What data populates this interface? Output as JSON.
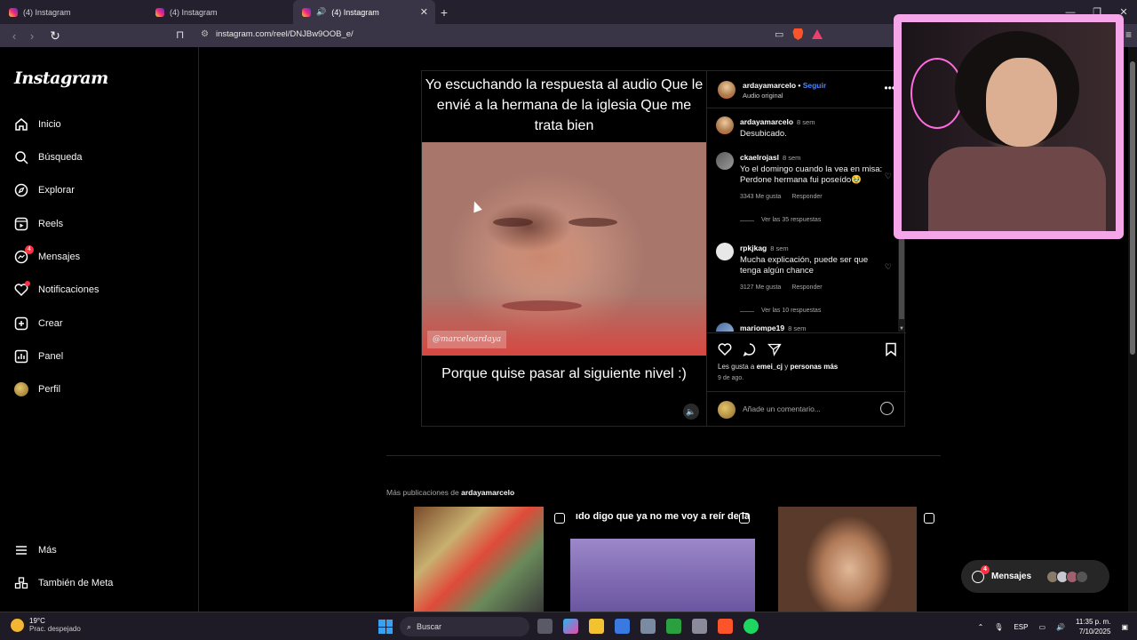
{
  "browser": {
    "tabs": [
      {
        "title": "(4) Instagram",
        "active": false
      },
      {
        "title": "(4) Instagram",
        "active": false
      },
      {
        "title": "(4) Instagram",
        "active": true
      }
    ],
    "url": "instagram.com/reel/DNJBw9OOB_e/"
  },
  "sidebar": {
    "logo": "Instagram",
    "items": [
      {
        "label": "Inicio",
        "icon": "home-icon"
      },
      {
        "label": "Búsqueda",
        "icon": "search-icon"
      },
      {
        "label": "Explorar",
        "icon": "compass-icon"
      },
      {
        "label": "Reels",
        "icon": "reels-icon"
      },
      {
        "label": "Mensajes",
        "icon": "messenger-icon",
        "badge": "4"
      },
      {
        "label": "Notificaciones",
        "icon": "heart-icon"
      },
      {
        "label": "Crear",
        "icon": "plus-icon"
      },
      {
        "label": "Panel",
        "icon": "chart-icon"
      },
      {
        "label": "Perfil",
        "icon": "avatar"
      }
    ],
    "bottom": [
      {
        "label": "Más",
        "icon": "menu-icon"
      },
      {
        "label": "También de Meta",
        "icon": "meta-icon"
      }
    ]
  },
  "reel": {
    "caption_top": "Yo escuchando la respuesta al audio Que le envié a la hermana de la iglesia Que me trata bien",
    "watermark": "@marceloardaya",
    "caption_bottom": "Porque quise pasar al siguiente nivel :)",
    "author": "ardayamarcelo",
    "follow": "Seguir",
    "audio": "Audio original"
  },
  "comments": [
    {
      "user": "ardayamarcelo",
      "time": "8 sem",
      "text": "Desubicado.",
      "likes": "",
      "reply": "",
      "replies": ""
    },
    {
      "user": "ckaelrojasl",
      "time": "8 sem",
      "text": "Yo el domingo cuando la vea en misa: Perdone hermana fui poseído🥹",
      "likes": "3343 Me gusta",
      "reply": "Responder",
      "replies": "Ver las 35 respuestas"
    },
    {
      "user": "rpkjkag",
      "time": "8 sem",
      "text": "Mucha explicación, puede ser que tenga algún chance",
      "likes": "3127 Me gusta",
      "reply": "Responder",
      "replies": "Ver las 10 respuestas"
    },
    {
      "user": "mariompe19",
      "time": "8 sem",
      "text": "",
      "likes": "",
      "reply": "",
      "replies": ""
    }
  ],
  "actions": {
    "likes_prefix": "Les gusta a",
    "likes_user": "emei_cj",
    "likes_mid": "y",
    "likes_more": "personas más",
    "date": "9 de ago.",
    "comment_placeholder": "Añade un comentario..."
  },
  "more_posts": {
    "prefix": "Más publicaciones de",
    "user": "ardayamarcelo",
    "thumb2_text": "ıdo digo que ya no me voy a reír de la"
  },
  "messages_pill": {
    "label": "Mensajes",
    "badge": "4"
  },
  "taskbar": {
    "temp": "19°C",
    "weather": "Prac. despejado",
    "search": "Buscar",
    "lang": "ESP",
    "time": "11:35 p. m.",
    "date": "7/10/2025"
  },
  "colors": {
    "accent_blue": "#4a86ff",
    "badge_red": "#ff3040",
    "cam_border": "#f5a6e8"
  }
}
